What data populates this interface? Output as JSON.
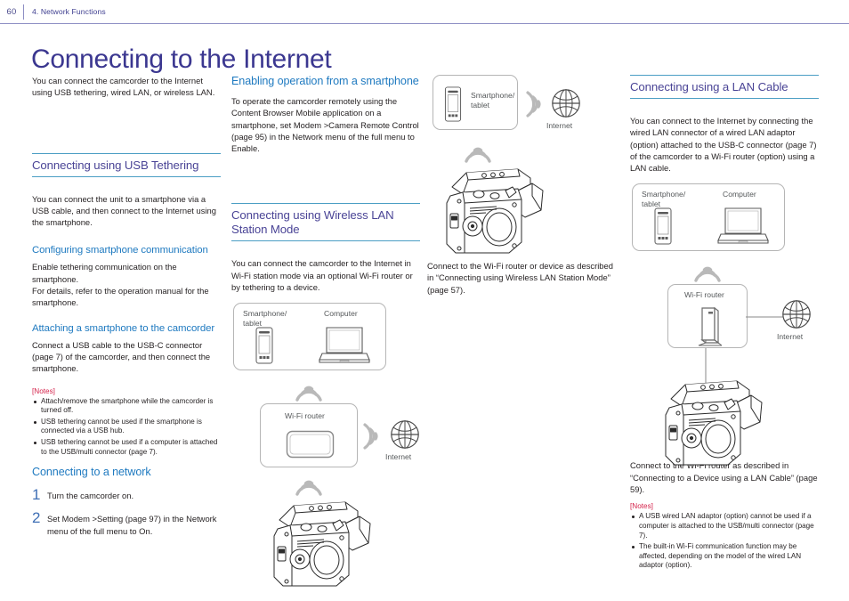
{
  "header": {
    "page_number": "60",
    "chapter": "4. Network Functions"
  },
  "title": "Connecting to the Internet",
  "colors": {
    "title_purple": "#3b3790",
    "heading_purple": "#4a4496",
    "rule_teal": "#4b9ec4",
    "subhead_blue": "#1f7ac0",
    "notes_red": "#d4224a",
    "step_blue": "#3f6fb5",
    "diagram_gray": "#b5b5b5",
    "diagram_label": "#55585a"
  },
  "col1": {
    "intro": "You can connect the camcorder to the Internet using USB tethering, wired LAN, or wireless LAN.",
    "h2_usb_tethering": "Connecting using USB Tethering",
    "usb_intro": "You can connect the unit to a smartphone via a USB cable, and then connect to the Internet using the smartphone.",
    "h3_configuring": "Configuring smartphone communication",
    "configuring_body": "Enable tethering communication on the smartphone.\nFor details, refer to the operation manual for the smartphone.",
    "h3_attaching": "Attaching a smartphone to the camcorder",
    "attaching_body": "Connect a USB cable to the USB-C connector (page 7) of the camcorder, and then connect the smartphone.",
    "notes_label": "[Notes]",
    "notes": [
      "Attach/remove the smartphone while the camcorder is turned off.",
      "USB tethering cannot be used if the smartphone is connected via a USB hub.",
      "USB tethering cannot be used if a computer is attached to the USB/multi connector (page 7)."
    ],
    "h3_connecting_network": "Connecting to a network",
    "steps": [
      {
        "num": "1",
        "text": "Turn the camcorder on."
      },
      {
        "num": "2",
        "text": "Set Modem >Setting (page 97) in the Network menu of the full menu to On."
      }
    ]
  },
  "col2": {
    "h3_enabling": "Enabling operation from a smartphone",
    "enabling_body": "To operate the camcorder remotely using the Content Browser Mobile application on a smartphone, set Modem >Camera Remote Control (page 95) in the Network menu of the full menu to Enable.",
    "h2_wireless_lan": "Connecting using Wireless LAN Station Mode",
    "wireless_body": "You can connect the camcorder to the Internet in Wi-Fi station mode via an optional Wi-Fi router or by tethering to a device.",
    "diagram": {
      "smartphone_label": "Smartphone/\ntablet",
      "computer_label": "Computer",
      "router_label": "Wi-Fi router",
      "internet_label": "Internet"
    }
  },
  "col3": {
    "diagram": {
      "smartphone_label": "Smartphone/\ntablet",
      "internet_label": "Internet"
    },
    "caption": "Connect to the Wi-Fi router or device as described in “Connecting using Wireless LAN Station Mode” (page 57)."
  },
  "col4": {
    "h2_lan_cable": "Connecting using a LAN Cable",
    "lan_body": "You can connect to the Internet by connecting the wired LAN connector of a wired LAN adaptor (option) attached to the USB-C connector (page 7) of the camcorder to a Wi-Fi router (option) using a LAN cable.",
    "diagram": {
      "smartphone_label": "Smartphone/\ntablet",
      "computer_label": "Computer",
      "router_label": "Wi-Fi router",
      "internet_label": "Internet"
    },
    "caption": "Connect to the Wi-Fi router as described in “Connecting to a Device using a LAN Cable” (page 59).",
    "notes_label": "[Notes]",
    "notes": [
      "A USB wired LAN adaptor (option) cannot be used if a computer is attached to the USB/multi connector (page 7).",
      "The built-in Wi-Fi communication function may be affected, depending on the model of the wired LAN adaptor (option)."
    ]
  },
  "icons": {
    "smartphone": "smartphone-icon",
    "laptop": "laptop-icon",
    "router_box": "wifi-router-icon",
    "router_tower": "wifi-router-tower-icon",
    "globe": "globe-icon",
    "wifi_arcs": "wifi-signal-icon",
    "camcorder": "camcorder-icon"
  }
}
